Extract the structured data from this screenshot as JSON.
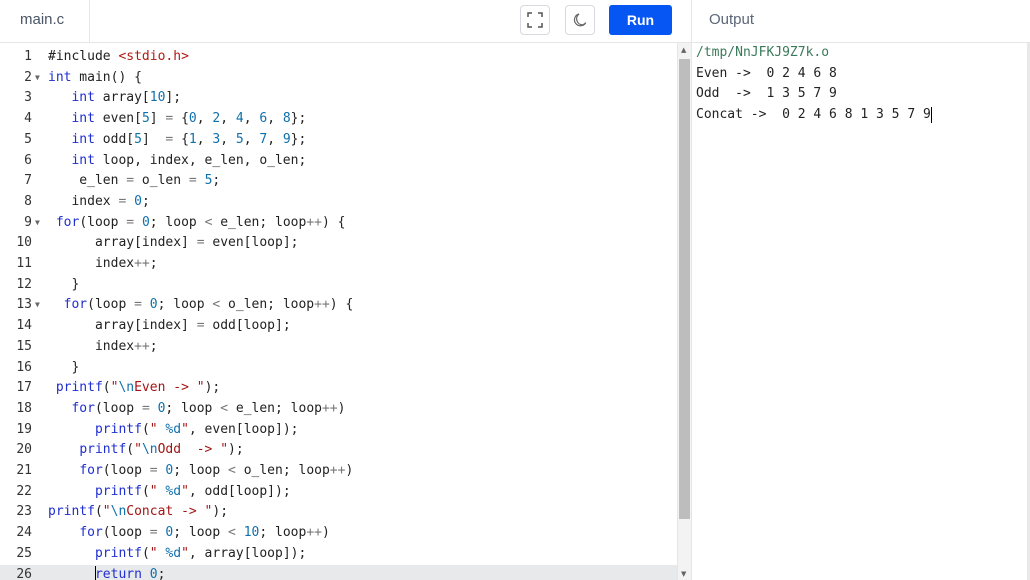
{
  "file_tab": {
    "label": "main.c"
  },
  "toolbar": {
    "run_label": "Run",
    "fullscreen_icon": "fullscreen-icon",
    "theme_icon": "moon-icon"
  },
  "output": {
    "title": "Output",
    "lines": [
      "/tmp/NnJFKJ9Z7k.o",
      "Even ->  0 2 4 6 8",
      "Odd  ->  1 3 5 7 9",
      "Concat ->  0 2 4 6 8 1 3 5 7 9"
    ]
  },
  "editor": {
    "active_line": 26,
    "lines": [
      {
        "n": "1",
        "fold": false,
        "code": "#include <stdio.h>"
      },
      {
        "n": "2",
        "fold": true,
        "code": "int main() {"
      },
      {
        "n": "3",
        "fold": false,
        "code": "   int array[10];"
      },
      {
        "n": "4",
        "fold": false,
        "code": "   int even[5] = {0, 2, 4, 6, 8};"
      },
      {
        "n": "5",
        "fold": false,
        "code": "   int odd[5]  = {1, 3, 5, 7, 9};"
      },
      {
        "n": "6",
        "fold": false,
        "code": "   int loop, index, e_len, o_len;"
      },
      {
        "n": "7",
        "fold": false,
        "code": "    e_len = o_len = 5;"
      },
      {
        "n": "8",
        "fold": false,
        "code": "   index = 0;"
      },
      {
        "n": "9",
        "fold": true,
        "code": " for(loop = 0; loop < e_len; loop++) {"
      },
      {
        "n": "10",
        "fold": false,
        "code": "      array[index] = even[loop];"
      },
      {
        "n": "11",
        "fold": false,
        "code": "      index++;"
      },
      {
        "n": "12",
        "fold": false,
        "code": "   }"
      },
      {
        "n": "13",
        "fold": true,
        "code": "  for(loop = 0; loop < o_len; loop++) {"
      },
      {
        "n": "14",
        "fold": false,
        "code": "      array[index] = odd[loop];"
      },
      {
        "n": "15",
        "fold": false,
        "code": "      index++;"
      },
      {
        "n": "16",
        "fold": false,
        "code": "   }"
      },
      {
        "n": "17",
        "fold": false,
        "code": " printf(\"\\nEven -> \");"
      },
      {
        "n": "18",
        "fold": false,
        "code": "   for(loop = 0; loop < e_len; loop++)"
      },
      {
        "n": "19",
        "fold": false,
        "code": "      printf(\" %d\", even[loop]);"
      },
      {
        "n": "20",
        "fold": false,
        "code": "    printf(\"\\nOdd  -> \");"
      },
      {
        "n": "21",
        "fold": false,
        "code": "    for(loop = 0; loop < o_len; loop++)"
      },
      {
        "n": "22",
        "fold": false,
        "code": "      printf(\" %d\", odd[loop]);"
      },
      {
        "n": "23",
        "fold": false,
        "code": "printf(\"\\nConcat -> \");"
      },
      {
        "n": "24",
        "fold": false,
        "code": "    for(loop = 0; loop < 10; loop++)"
      },
      {
        "n": "25",
        "fold": false,
        "code": "      printf(\" %d\", array[loop]);"
      },
      {
        "n": "26",
        "fold": false,
        "code": "      return 0;"
      }
    ]
  },
  "colors": {
    "run_button": "#0556f3",
    "keyword": "#1f2ed0",
    "number": "#0f70ad",
    "string": "#a31515"
  }
}
